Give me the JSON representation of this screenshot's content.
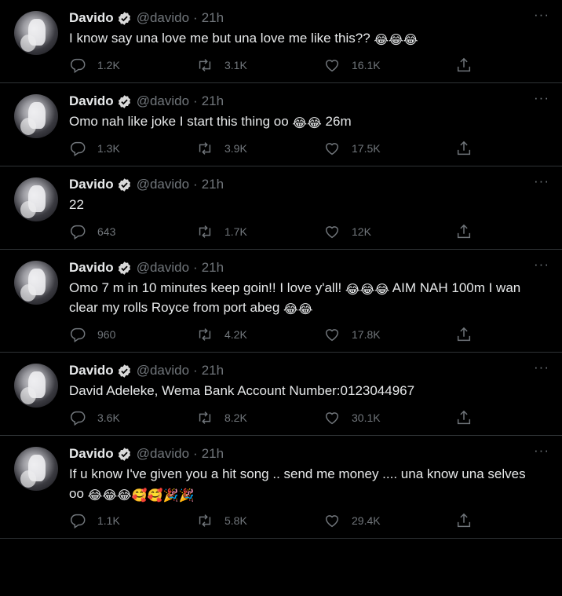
{
  "colors": {
    "background": "#000000",
    "text": "#e7e9ea",
    "muted": "#71767b",
    "verified": "#d9d9d9",
    "divider": "#2f3336"
  },
  "tweets": [
    {
      "name": "Davido",
      "handle": "@davido",
      "separator": "·",
      "time": "21h",
      "more": "···",
      "text_parts": [
        {
          "type": "text",
          "value": "I know say una love me but una love me like this?? "
        },
        {
          "type": "emoji",
          "value": "😂😂😂"
        }
      ],
      "replies": "1.2K",
      "retweets": "3.1K",
      "likes": "16.1K"
    },
    {
      "name": "Davido",
      "handle": "@davido",
      "separator": "·",
      "time": "21h",
      "more": "···",
      "text_parts": [
        {
          "type": "text",
          "value": "Omo nah like joke I start this thing oo "
        },
        {
          "type": "emoji",
          "value": "😂😂"
        },
        {
          "type": "text",
          "value": " 26m"
        }
      ],
      "replies": "1.3K",
      "retweets": "3.9K",
      "likes": "17.5K"
    },
    {
      "name": "Davido",
      "handle": "@davido",
      "separator": "·",
      "time": "21h",
      "more": "···",
      "text_parts": [
        {
          "type": "text",
          "value": "22"
        }
      ],
      "replies": "643",
      "retweets": "1.7K",
      "likes": "12K"
    },
    {
      "name": "Davido",
      "handle": "@davido",
      "separator": "·",
      "time": "21h",
      "more": "···",
      "text_parts": [
        {
          "type": "text",
          "value": "Omo 7 m in 10 minutes keep goin!! I love y'all! "
        },
        {
          "type": "emoji",
          "value": "😂😂😂"
        },
        {
          "type": "text",
          "value": " AIM NAH 100m I wan clear my rolls Royce from port abeg "
        },
        {
          "type": "emoji",
          "value": "😂😂"
        }
      ],
      "replies": "960",
      "retweets": "4.2K",
      "likes": "17.8K"
    },
    {
      "name": "Davido",
      "handle": "@davido",
      "separator": "·",
      "time": "21h",
      "more": "···",
      "text_parts": [
        {
          "type": "text",
          "value": "David Adeleke, Wema Bank Account Number:0123044967"
        }
      ],
      "replies": "3.6K",
      "retweets": "8.2K",
      "likes": "30.1K"
    },
    {
      "name": "Davido",
      "handle": "@davido",
      "separator": "·",
      "time": "21h",
      "more": "···",
      "text_parts": [
        {
          "type": "text",
          "value": "If u know I've given you a hit song .. send me money .... una know una selves oo "
        },
        {
          "type": "emoji",
          "value": "😂😂😂🥰🥰🎉🎉"
        }
      ],
      "replies": "1.1K",
      "retweets": "5.8K",
      "likes": "29.4K"
    }
  ]
}
